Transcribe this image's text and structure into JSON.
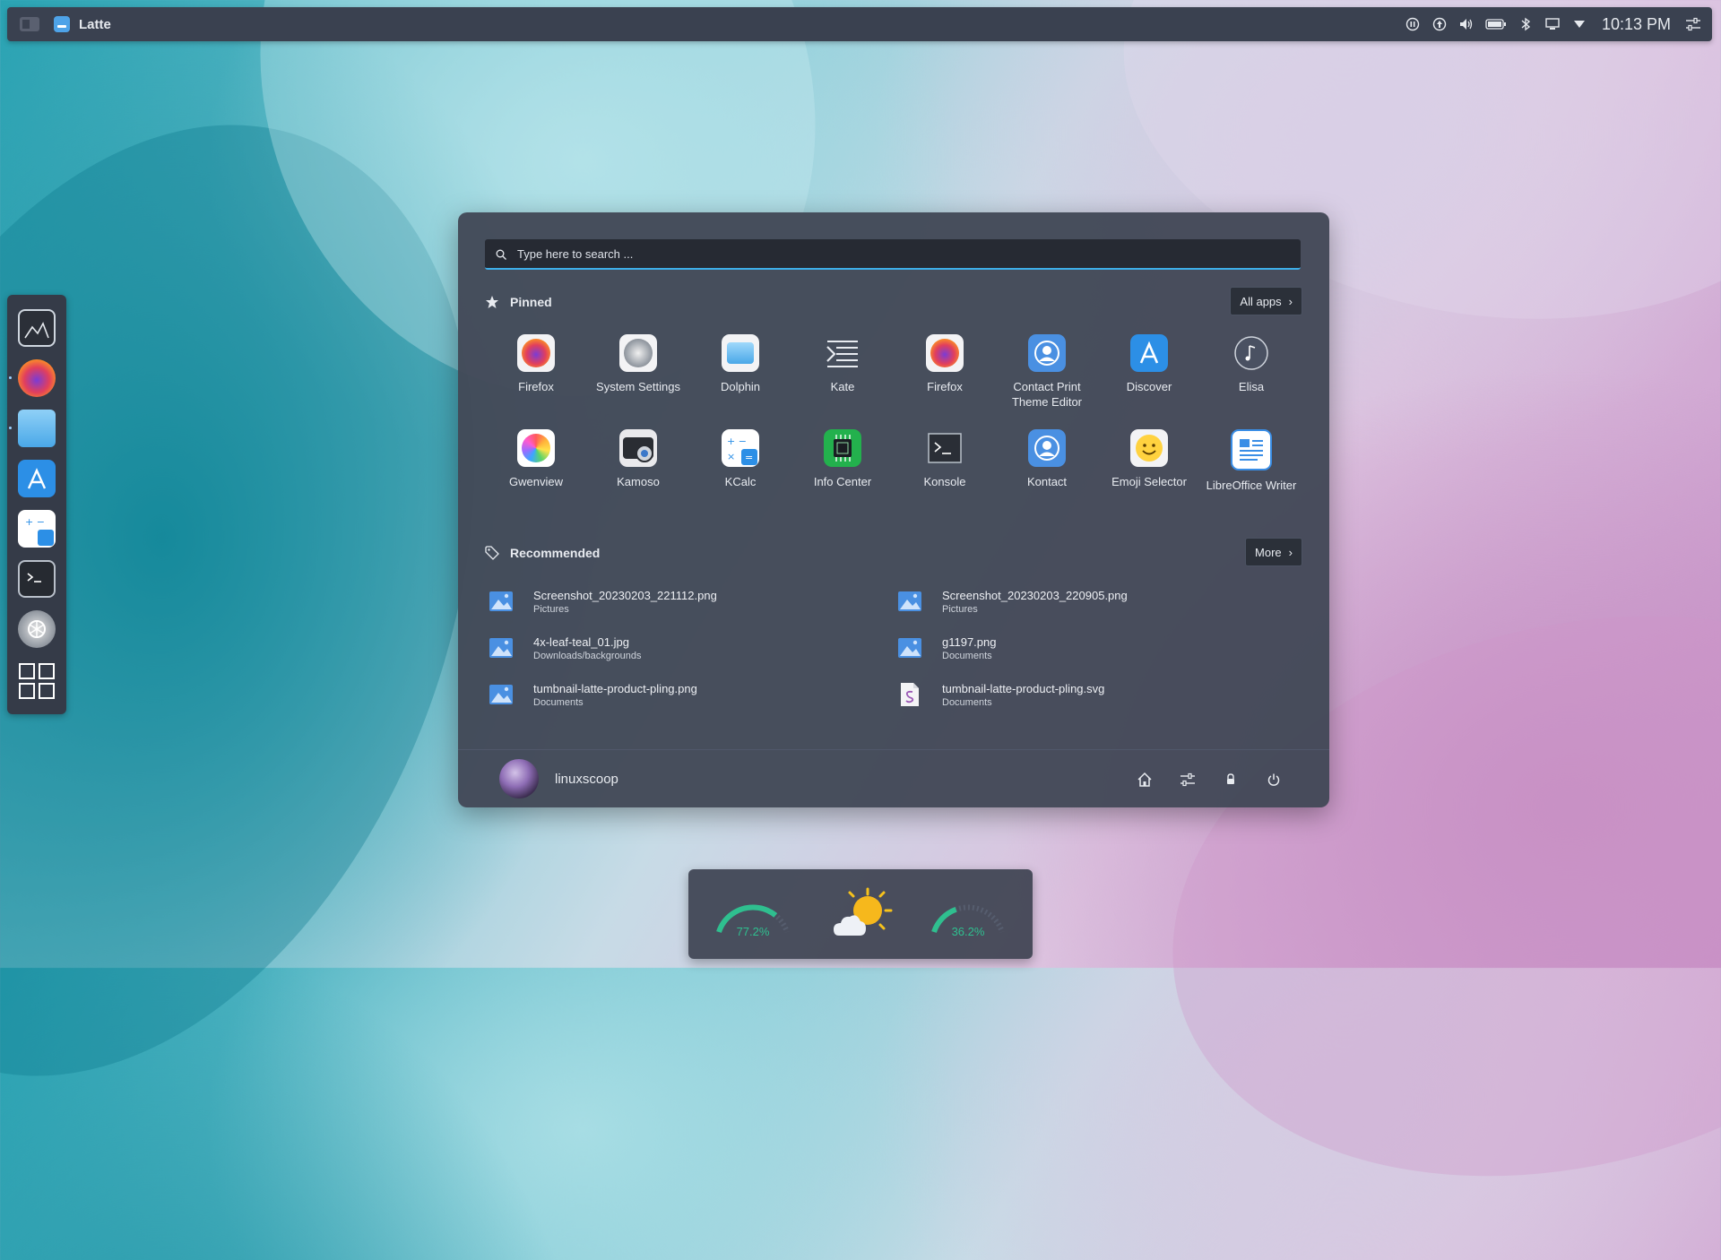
{
  "topbar": {
    "app_name": "Latte",
    "clock": "10:13 PM",
    "tray_icons": [
      "pause-icon",
      "updates-icon",
      "volume-icon",
      "battery-icon",
      "bluetooth-icon",
      "display-icon",
      "network-icon",
      "settings-sliders-icon"
    ]
  },
  "dock": {
    "items": [
      "show-desktop",
      "firefox",
      "dolphin",
      "discover",
      "kcalc",
      "konsole",
      "system-settings",
      "app-grid"
    ]
  },
  "launcher": {
    "search_placeholder": "Type here to search ...",
    "pinned_label": "Pinned",
    "all_apps_label": "All apps",
    "pinned_apps": [
      {
        "label": "Firefox",
        "icon": "firefox-icon"
      },
      {
        "label": "System Settings",
        "icon": "settings-icon"
      },
      {
        "label": "Dolphin",
        "icon": "folder-icon"
      },
      {
        "label": "Kate",
        "icon": "kate-icon"
      },
      {
        "label": "Firefox",
        "icon": "firefox-icon"
      },
      {
        "label": "Contact Print Theme Editor",
        "icon": "contact-icon"
      },
      {
        "label": "Discover",
        "icon": "store-icon"
      },
      {
        "label": "Elisa",
        "icon": "music-icon"
      },
      {
        "label": "Gwenview",
        "icon": "photos-icon"
      },
      {
        "label": "Kamoso",
        "icon": "camera-icon"
      },
      {
        "label": "KCalc",
        "icon": "calculator-icon"
      },
      {
        "label": "Info Center",
        "icon": "chip-icon"
      },
      {
        "label": "Konsole",
        "icon": "terminal-icon"
      },
      {
        "label": "Kontact",
        "icon": "contact-icon"
      },
      {
        "label": "Emoji Selector",
        "icon": "emoji-icon"
      },
      {
        "label": "LibreOffice Writer",
        "icon": "writer-icon"
      }
    ],
    "recommended_label": "Recommended",
    "more_label": "More",
    "recommended": [
      {
        "name": "Screenshot_20230203_221112.png",
        "dir": "Pictures",
        "icon": "image-file-icon"
      },
      {
        "name": "Screenshot_20230203_220905.png",
        "dir": "Pictures",
        "icon": "image-file-icon"
      },
      {
        "name": "4x-leaf-teal_01.jpg",
        "dir": "Downloads/backgrounds",
        "icon": "image-file-icon"
      },
      {
        "name": "g1197.png",
        "dir": "Documents",
        "icon": "image-file-icon"
      },
      {
        "name": "tumbnail-latte-product-pling.png",
        "dir": "Documents",
        "icon": "image-file-icon"
      },
      {
        "name": "tumbnail-latte-product-pling.svg",
        "dir": "Documents",
        "icon": "svg-file-icon"
      }
    ],
    "user": "linuxscoop"
  },
  "widget": {
    "cpu": "77.2%",
    "cpu_level": 0.772,
    "ram": "36.2%",
    "ram_level": 0.362,
    "accent": "#2fbf8f"
  }
}
